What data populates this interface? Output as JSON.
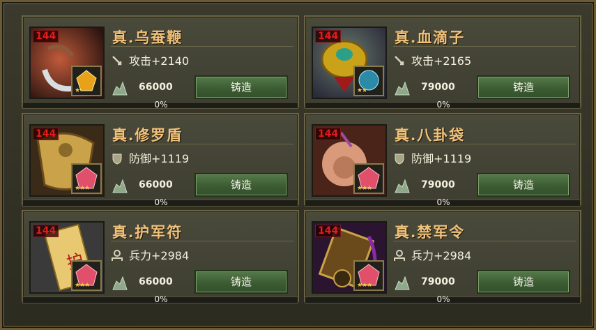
{
  "panels": [
    {
      "title": "真.乌蚕鞭",
      "level": "144",
      "stat_type": "attack-icon",
      "stat": "攻击+2140",
      "cost": "66000",
      "button": "铸造",
      "progress": "0%",
      "progress_value": 0,
      "theme": "#7a3a2a",
      "gem_color": "#e8a21a"
    },
    {
      "title": "真.血滴子",
      "level": "144",
      "stat_type": "attack-icon",
      "stat": "攻击+2165",
      "cost": "79000",
      "button": "铸造",
      "progress": "0%",
      "progress_value": 0,
      "theme": "#4a5a6a",
      "gem_color": "#3aa9c4"
    },
    {
      "title": "真.修罗盾",
      "level": "144",
      "stat_type": "shield-icon",
      "stat": "防御+1119",
      "cost": "66000",
      "button": "铸造",
      "progress": "0%",
      "progress_value": 0,
      "theme": "#8a6a2a",
      "gem_color": "#e0506a"
    },
    {
      "title": "真.八卦袋",
      "level": "144",
      "stat_type": "shield-icon",
      "stat": "防御+1119",
      "cost": "79000",
      "button": "铸造",
      "progress": "0%",
      "progress_value": 0,
      "theme": "#7a4030",
      "gem_color": "#e0506a"
    },
    {
      "title": "真.护军符",
      "level": "144",
      "stat_type": "soldier-icon",
      "stat": "兵力+2984",
      "cost": "66000",
      "button": "铸造",
      "progress": "0%",
      "progress_value": 0,
      "theme": "#b89a4a",
      "gem_color": "#e0506a"
    },
    {
      "title": "真.禁军令",
      "level": "144",
      "stat_type": "soldier-icon",
      "stat": "兵力+2984",
      "cost": "79000",
      "button": "铸造",
      "progress": "0%",
      "progress_value": 0,
      "theme": "#5a2a6a",
      "gem_color": "#e0506a"
    }
  ],
  "colors": {
    "title": "#f0c27a",
    "level": "#e21b1b",
    "button": "#3c5c33"
  }
}
